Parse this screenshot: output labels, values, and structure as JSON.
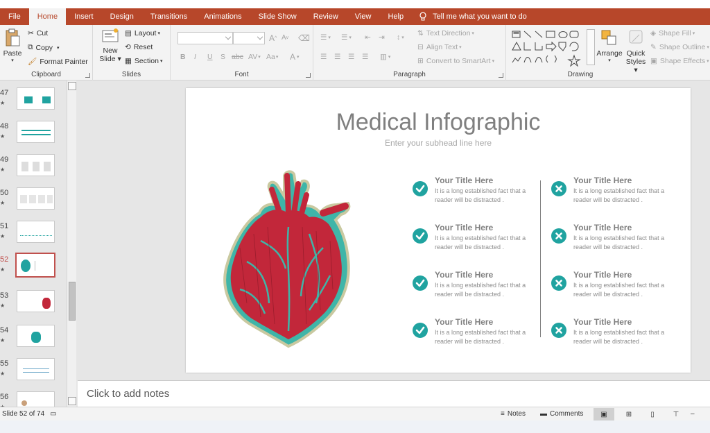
{
  "tabs": [
    "File",
    "Home",
    "Insert",
    "Design",
    "Transitions",
    "Animations",
    "Slide Show",
    "Review",
    "View",
    "Help"
  ],
  "active_tab": "Home",
  "tell_me": "Tell me what you want to do",
  "ribbon": {
    "clipboard": {
      "paste": "Paste",
      "cut": "Cut",
      "copy": "Copy",
      "format_painter": "Format Painter",
      "label": "Clipboard"
    },
    "slides": {
      "new_slide_1": "New",
      "new_slide_2": "Slide",
      "layout": "Layout",
      "reset": "Reset",
      "section": "Section",
      "label": "Slides"
    },
    "font": {
      "label": "Font",
      "bold": "B",
      "italic": "I",
      "underline": "U",
      "strike": "S",
      "abc": "abc",
      "av": "AV",
      "aa": "Aa",
      "grow": "A",
      "shrink": "A",
      "color": "A"
    },
    "paragraph": {
      "label": "Paragraph",
      "text_direction": "Text Direction",
      "align_text": "Align Text",
      "smartart": "Convert to SmartArt"
    },
    "drawing": {
      "label": "Drawing",
      "arrange": "Arrange",
      "quick_styles_1": "Quick",
      "quick_styles_2": "Styles",
      "shape_fill": "Shape Fill",
      "shape_outline": "Shape Outline",
      "shape_effects": "Shape Effects"
    }
  },
  "thumbnails": [
    {
      "num": "47",
      "star": "★"
    },
    {
      "num": "48",
      "star": "★"
    },
    {
      "num": "49",
      "star": "★"
    },
    {
      "num": "50",
      "star": "★"
    },
    {
      "num": "51",
      "star": "★"
    },
    {
      "num": "52",
      "star": "★"
    },
    {
      "num": "53",
      "star": "★"
    },
    {
      "num": "54",
      "star": "★"
    },
    {
      "num": "55",
      "star": "★"
    },
    {
      "num": "56",
      "star": "★"
    }
  ],
  "selected_slide": "52",
  "slide": {
    "title": "Medical Infographic",
    "subtitle": "Enter your subhead line here",
    "items": [
      {
        "title": "Your Title Here",
        "text": "It is a long established fact that a reader will be distracted .",
        "icon": "check-icon"
      },
      {
        "title": "Your Title Here",
        "text": "It is a long established fact that a reader will be distracted .",
        "icon": "check-icon"
      },
      {
        "title": "Your Title Here",
        "text": "It is a long established fact that a reader will be distracted .",
        "icon": "check-icon"
      },
      {
        "title": "Your Title Here",
        "text": "It is a long established fact that a reader will be distracted .",
        "icon": "check-icon"
      },
      {
        "title": "Your Title Here",
        "text": "It is a long established fact that a reader will be distracted .",
        "icon": "x-icon"
      },
      {
        "title": "Your Title Here",
        "text": "It is a long established fact that a reader will be distracted .",
        "icon": "x-icon"
      },
      {
        "title": "Your Title Here",
        "text": "It is a long established fact that a reader will be distracted .",
        "icon": "x-icon"
      },
      {
        "title": "Your Title Here",
        "text": "It is a long established fact that a reader will be distracted .",
        "icon": "x-icon"
      }
    ]
  },
  "notes_placeholder": "Click to add notes",
  "status": {
    "slide_of": "Slide 52 of 74",
    "notes": "Notes",
    "comments": "Comments"
  },
  "colors": {
    "accent": "#b7472a",
    "teal": "#20a3a0",
    "heart_red": "#c2273a"
  }
}
